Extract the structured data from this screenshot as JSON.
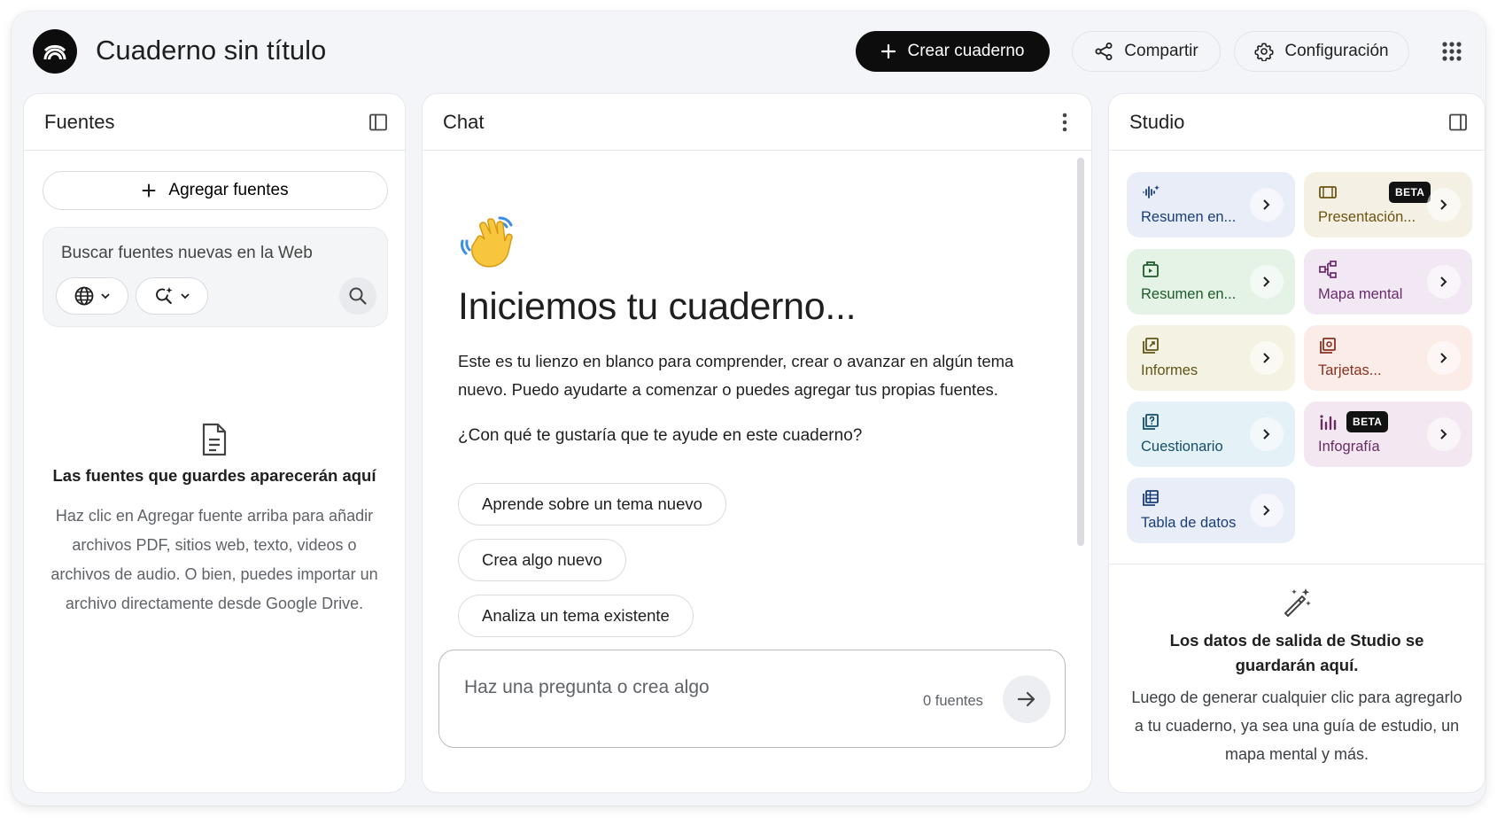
{
  "header": {
    "title": "Cuaderno sin título",
    "create_label": "Crear cuaderno",
    "share_label": "Compartir",
    "config_label": "Configuración"
  },
  "sources": {
    "title": "Fuentes",
    "add_label": "Agregar fuentes",
    "search_placeholder": "Buscar fuentes nuevas en la Web",
    "empty_title": "Las fuentes que guardes aparecerán aquí",
    "empty_desc": "Haz clic en Agregar fuente arriba para añadir archivos PDF, sitios web, texto, videos o archivos de audio. O bien, puedes importar un archivo directamente desde Google Drive."
  },
  "chat": {
    "title": "Chat",
    "heading": "Iniciemos tu cuaderno...",
    "description": "Este es tu lienzo en blanco para comprender, crear o avanzar en algún tema nuevo. Puedo ayudarte a comenzar o puedes agregar tus propias fuentes.",
    "question": "¿Con qué te gustaría que te ayude en este cuaderno?",
    "suggestions": [
      "Aprende sobre un tema nuevo",
      "Crea algo nuevo",
      "Analiza un tema existente"
    ],
    "input_placeholder": "Haz una pregunta o crea algo",
    "source_count": "0 fuentes"
  },
  "studio": {
    "title": "Studio",
    "tiles": [
      {
        "label": "Resumen en...",
        "icon": "audio-wave-icon"
      },
      {
        "label": "Presentación...",
        "icon": "slides-icon",
        "badge": "BETA"
      },
      {
        "label": "Resumen en...",
        "icon": "video-icon"
      },
      {
        "label": "Mapa mental",
        "icon": "mind-map-icon"
      },
      {
        "label": "Informes",
        "icon": "report-icon"
      },
      {
        "label": "Tarjetas...",
        "icon": "flashcards-icon"
      },
      {
        "label": "Cuestionario",
        "icon": "quiz-icon"
      },
      {
        "label": "Infografía",
        "icon": "infographic-icon",
        "badge": "BETA"
      },
      {
        "label": "Tabla de datos",
        "icon": "table-icon"
      }
    ],
    "empty_title": "Los datos de salida de Studio se guardarán aquí.",
    "empty_desc": "Luego de generar cualquier clic para agregarlo a tu cuaderno, ya sea una guía de estudio, un mapa mental y más."
  }
}
